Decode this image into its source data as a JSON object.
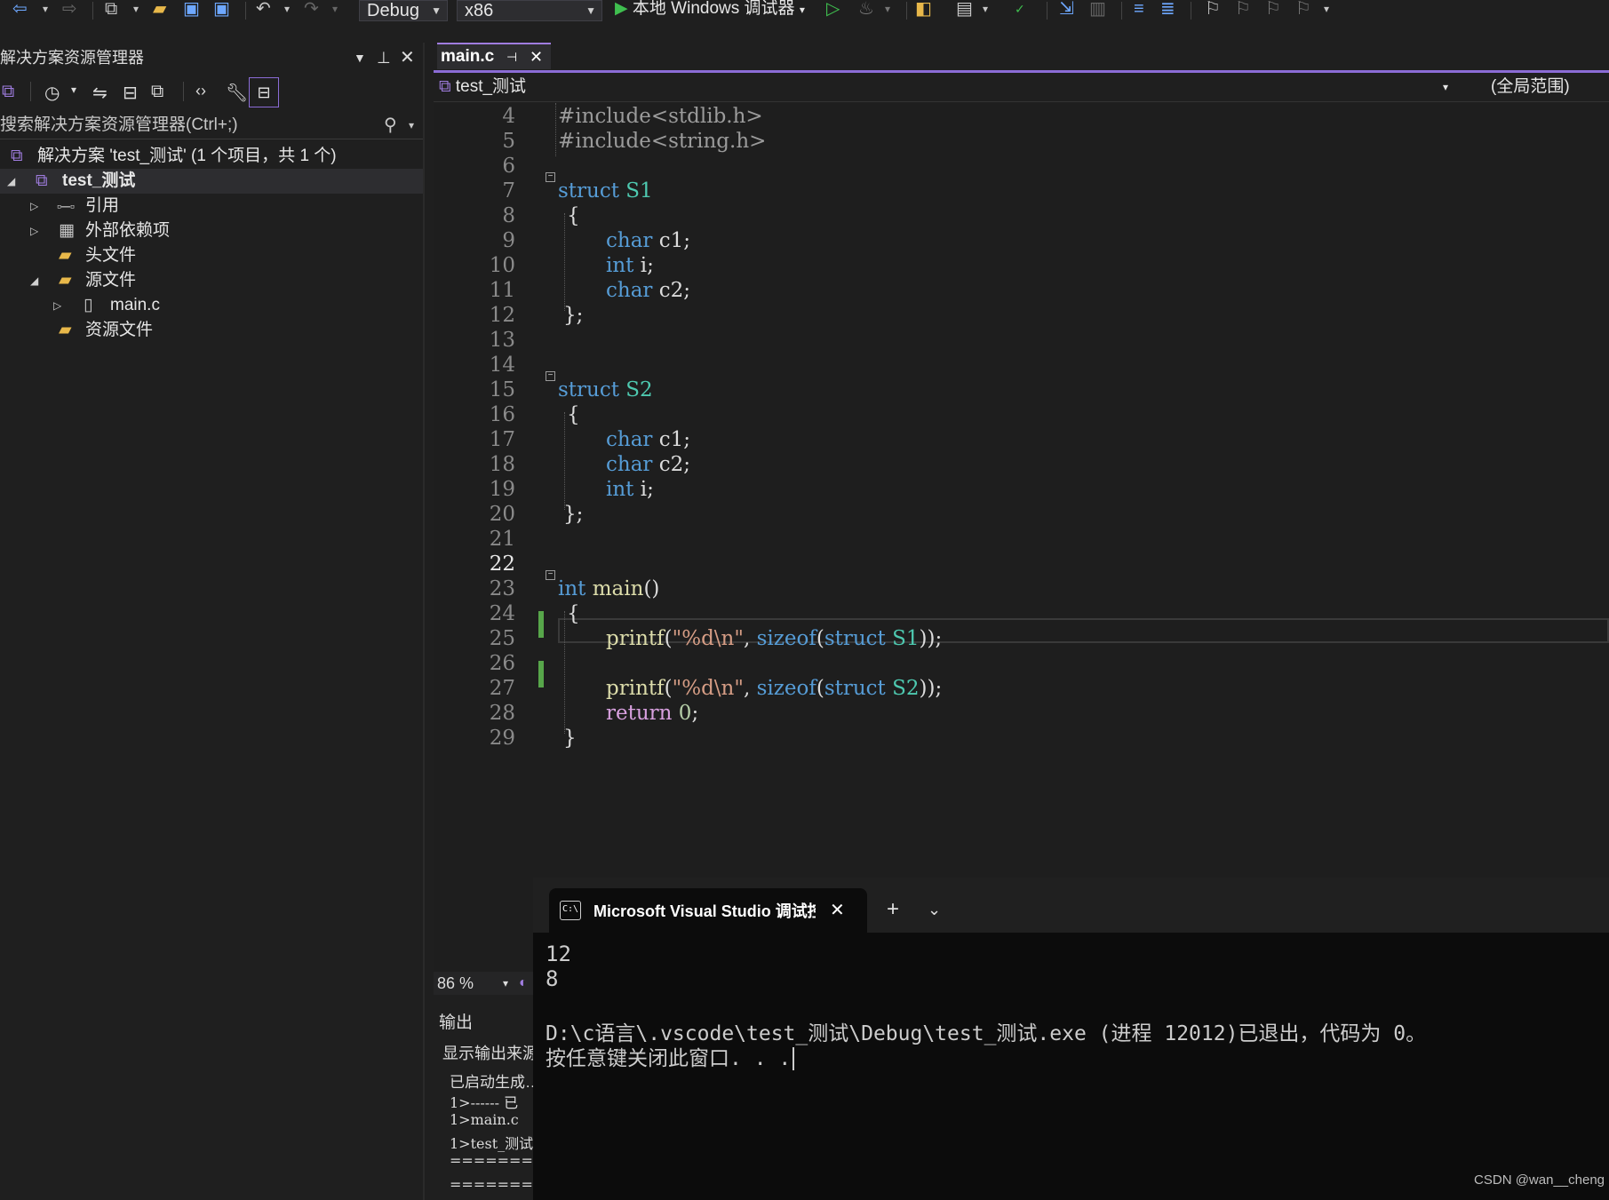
{
  "toolbar": {
    "config": "Debug",
    "platform": "x86",
    "run_label": "本地 Windows 调试器"
  },
  "solution_explorer": {
    "title": "解决方案资源管理器",
    "search_placeholder": "搜索解决方案资源管理器(Ctrl+;)",
    "solution_label": "解决方案 'test_测试' (1 个项目，共 1 个)",
    "items": [
      {
        "label": "test_测试",
        "bold": true
      },
      {
        "label": "引用"
      },
      {
        "label": "外部依赖项"
      },
      {
        "label": "头文件"
      },
      {
        "label": "源文件"
      },
      {
        "label": "main.c"
      },
      {
        "label": "资源文件"
      }
    ]
  },
  "editor": {
    "tab_label": "main.c",
    "nav_project": "test_测试",
    "nav_scope": "(全局范围)",
    "zoom": "86 %",
    "current_line": "22",
    "lines": [
      "4",
      "5",
      "6",
      "7",
      "8",
      "9",
      "10",
      "11",
      "12",
      "13",
      "14",
      "15",
      "16",
      "17",
      "18",
      "19",
      "20",
      "21",
      "22",
      "23",
      "24",
      "25",
      "26",
      "27",
      "28",
      "29"
    ],
    "code": {
      "l4": "#include<stdlib.h>",
      "l5": "#include<string.h>",
      "l7_kw": "struct",
      "l7_ty": "S1",
      "brace_open": "{",
      "brace_close": "};",
      "brace_end": "}",
      "char": "char",
      "int": "int",
      "c1": "c1;",
      "c2": "c2;",
      "i": "i;",
      "l15_ty": "S2",
      "main": "main",
      "parens": "()",
      "printf": "printf",
      "fmt": "\"%d\\n\"",
      "sizeof": "sizeof",
      "return": "return",
      "zero": "0"
    }
  },
  "output": {
    "title": "输出",
    "source": "显示输出来源",
    "lines": [
      "已启动生成…",
      "1>------ 已",
      "1>main.c",
      "1>test_测试",
      "==========",
      "========= 生"
    ]
  },
  "terminal": {
    "tab_title": "Microsoft Visual Studio 调试控制台",
    "lines": [
      "12",
      "8",
      "",
      "D:\\c语言\\.vscode\\test_测试\\Debug\\test_测试.exe (进程 12012)已退出，代码为 0。",
      "按任意键关闭此窗口. . ."
    ]
  },
  "watermark": "CSDN @wan__cheng"
}
